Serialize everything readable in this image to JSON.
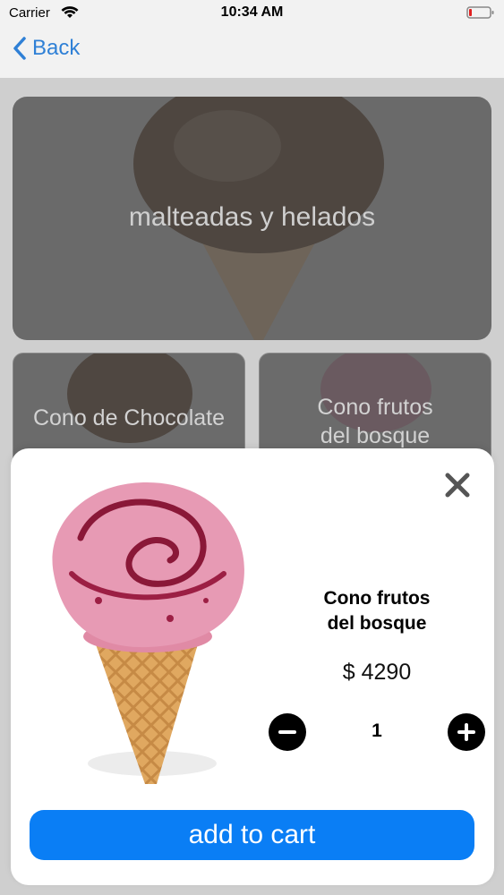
{
  "status_bar": {
    "carrier": "Carrier",
    "time": "10:34 AM"
  },
  "nav": {
    "back_label": "Back"
  },
  "background": {
    "hero_title": "malteadas y helados",
    "tiles": [
      {
        "title": "Cono de Chocolate"
      },
      {
        "title_line1": "Cono frutos",
        "title_line2": "del bosque"
      }
    ]
  },
  "modal": {
    "product_name_line1": "Cono frutos",
    "product_name_line2": "del bosque",
    "price": "$ 4290",
    "quantity": "1",
    "add_to_cart_label": "add to cart"
  },
  "colors": {
    "accent": "#0a7ef5",
    "back_link": "#2f80d6"
  }
}
